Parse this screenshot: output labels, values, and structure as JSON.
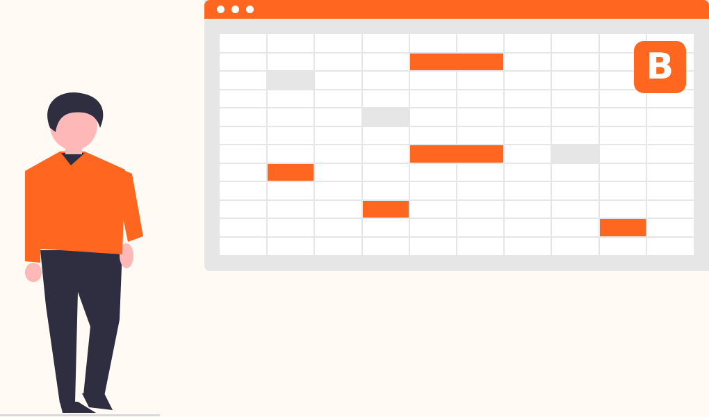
{
  "logo": {
    "letter": "B",
    "color": "#ff6720"
  },
  "colors": {
    "accent": "#ff6720",
    "window": "#e6e6e6",
    "sheet": "#ffffff",
    "background": "#fffaf3",
    "skin": "#ffb8b8",
    "hair": "#2f2e41"
  },
  "spreadsheet": {
    "rows": 12,
    "columns": 10
  },
  "highlighted_cells": [
    {
      "row": 1,
      "col": 4,
      "span": 2,
      "color": "accent"
    },
    {
      "row": 2,
      "col": 1,
      "span": 1,
      "color": "gray"
    },
    {
      "row": 4,
      "col": 3,
      "span": 1,
      "color": "gray"
    },
    {
      "row": 6,
      "col": 4,
      "span": 2,
      "color": "accent"
    },
    {
      "row": 6,
      "col": 7,
      "span": 1,
      "color": "gray"
    },
    {
      "row": 7,
      "col": 1,
      "span": 1,
      "color": "accent"
    },
    {
      "row": 9,
      "col": 3,
      "span": 1,
      "color": "accent"
    },
    {
      "row": 10,
      "col": 8,
      "span": 1,
      "color": "accent"
    }
  ]
}
